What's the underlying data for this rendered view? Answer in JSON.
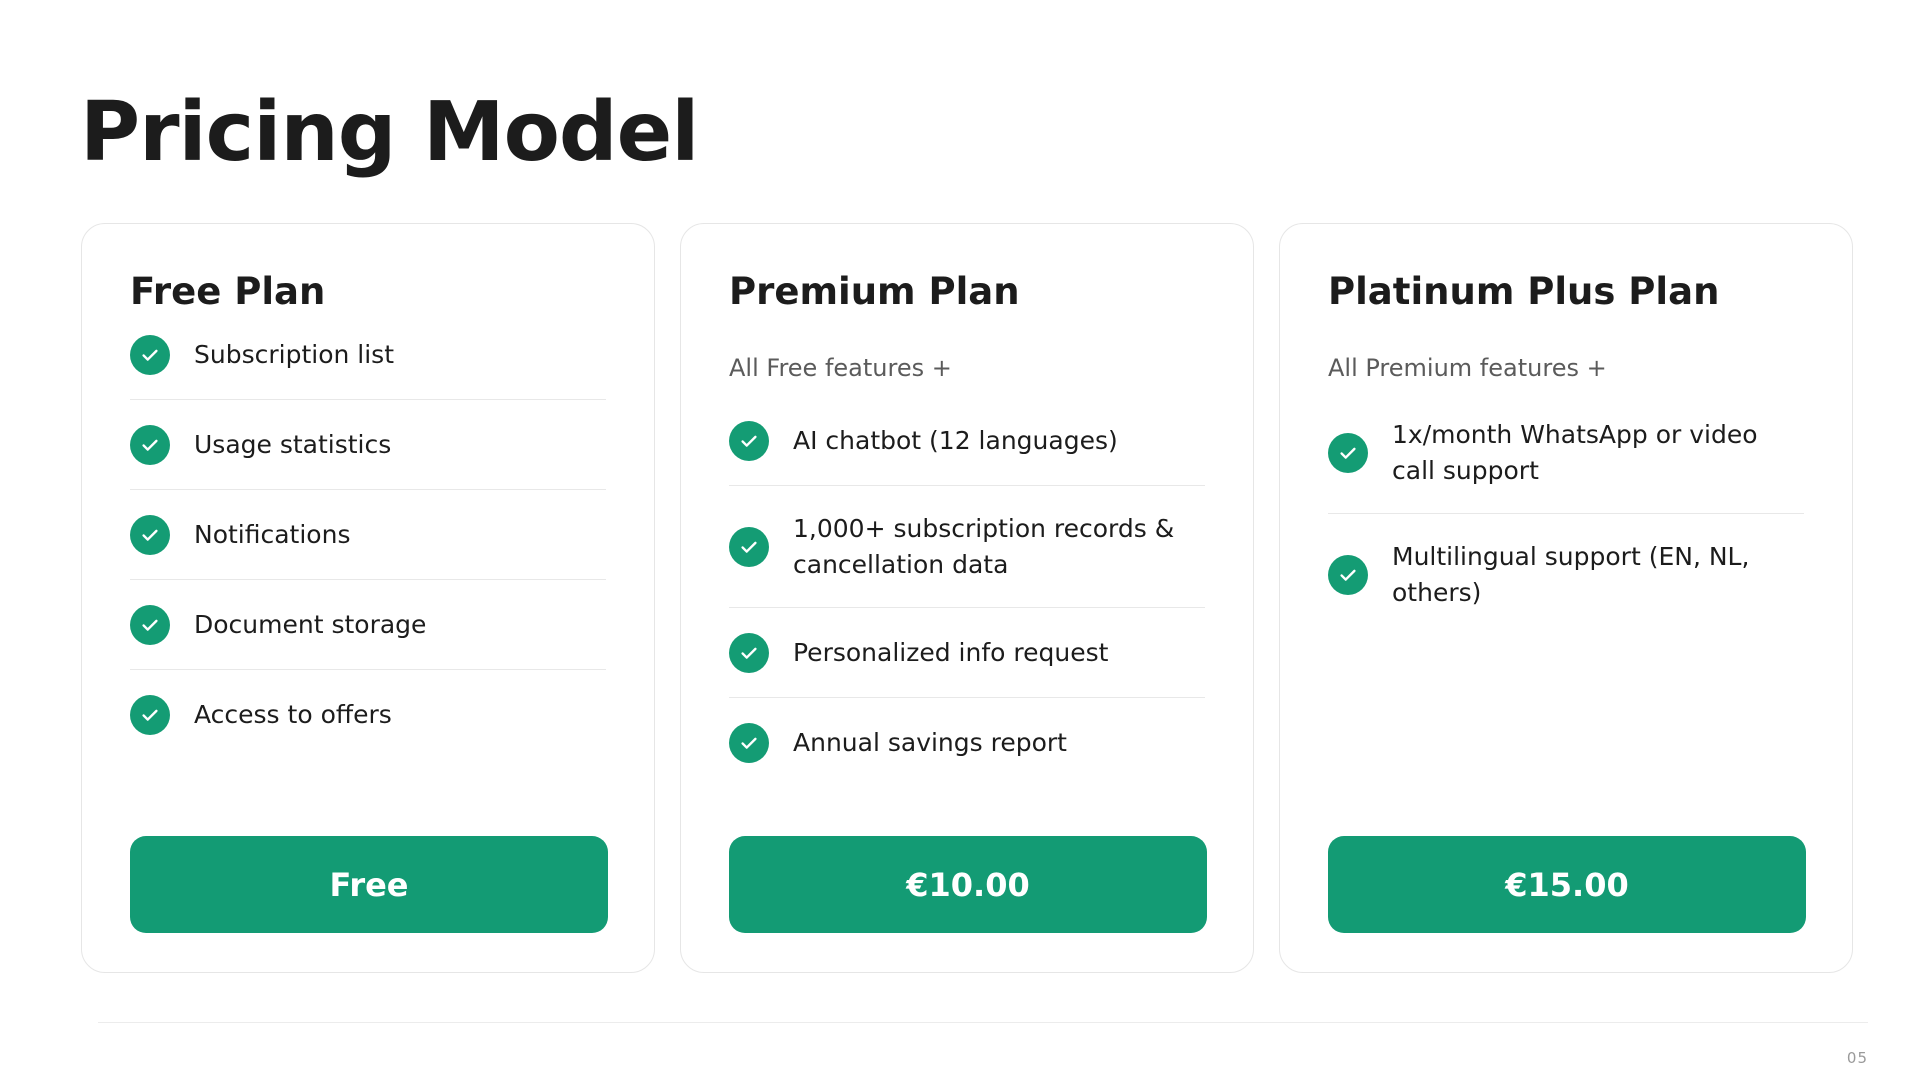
{
  "page": {
    "title": "Pricing Model",
    "page_number": "05"
  },
  "colors": {
    "accent": "#139b74",
    "text": "#1c1c1c",
    "muted": "#5b5b5b",
    "border": "#e6e6e6"
  },
  "plans": [
    {
      "title": "Free Plan",
      "subtitle": "",
      "features": [
        "Subscription list",
        "Usage statistics",
        "Notifications",
        "Document storage",
        "Access to offers"
      ],
      "price_label": "Free"
    },
    {
      "title": "Premium Plan",
      "subtitle": "All Free features +",
      "features": [
        "AI chatbot (12 languages)",
        "1,000+ subscription records & cancellation data",
        "Personalized info request",
        "Annual savings report"
      ],
      "price_label": "€10.00"
    },
    {
      "title": "Platinum Plus Plan",
      "subtitle": "All Premium features +",
      "features": [
        "1x/month WhatsApp or video call support",
        "Multilingual support (EN, NL, others)"
      ],
      "price_label": "€15.00"
    }
  ],
  "icons": {
    "feature_check": "check-circle-icon"
  }
}
